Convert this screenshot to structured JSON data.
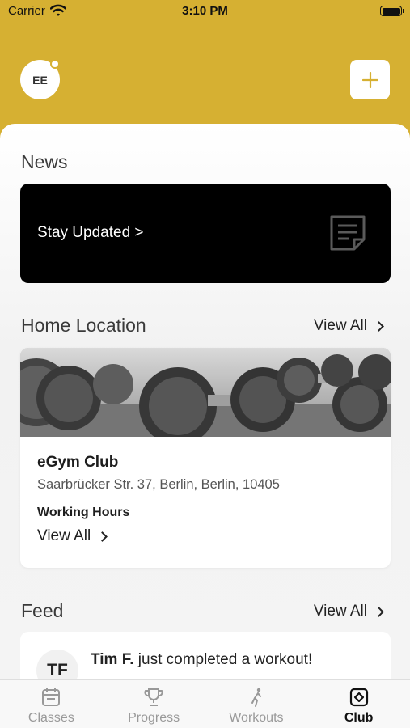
{
  "status_bar": {
    "carrier": "Carrier",
    "time": "3:10 PM"
  },
  "header": {
    "avatar_initials": "EE",
    "add_icon": "plus-icon"
  },
  "news": {
    "title": "News",
    "card_label": "Stay Updated >",
    "card_icon": "note-icon"
  },
  "home_location": {
    "title": "Home Location",
    "view_all": "View All",
    "club_name": "eGym Club",
    "address": "Saarbrücker Str. 37, Berlin, Berlin, 10405",
    "working_hours_label": "Working Hours",
    "working_hours_view_all": "View All"
  },
  "feed": {
    "title": "Feed",
    "view_all": "View All",
    "items": [
      {
        "initials": "TF",
        "user": "Tim F.",
        "action": " just completed a workout!"
      }
    ]
  },
  "tabs": [
    {
      "label": "Classes",
      "icon": "calendar-icon",
      "active": false
    },
    {
      "label": "Progress",
      "icon": "trophy-icon",
      "active": false
    },
    {
      "label": "Workouts",
      "icon": "figure-icon",
      "active": false
    },
    {
      "label": "Club",
      "icon": "club-icon",
      "active": true
    }
  ],
  "colors": {
    "accent": "#d6b032",
    "news_card": "#000000",
    "tab_inactive": "#999999",
    "tab_active": "#111111"
  }
}
